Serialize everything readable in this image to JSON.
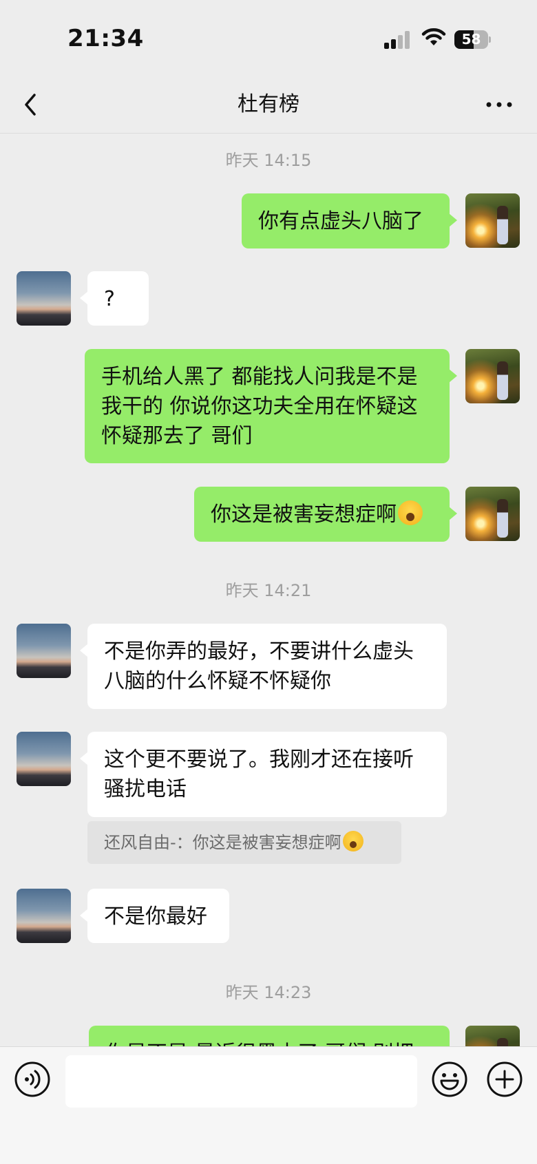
{
  "status_bar": {
    "time": "21:34",
    "battery_level": "58",
    "battery_fraction": 0.58
  },
  "header": {
    "back_icon": "chevron-left-icon",
    "title": "杜有榜",
    "more_icon": "more-dots-icon"
  },
  "messages": {
    "sep_1": "昨天 14:15",
    "m1": "你有点虚头八脑了",
    "m2": "?",
    "m3": "手机给人黑了 都能找人问我是不是\n我干的 你说你这功夫全用在怀疑这\n怀疑那去了 哥们",
    "m4": "你这是被害妄想症啊",
    "sep_2": "昨天 14:21",
    "m5": "不是你弄的最好，不要讲什么虚头\n八脑的什么怀疑不怀疑你",
    "m6": "这个更不要说了。我刚才还在接听\n骚扰电话",
    "quote": "还风自由-：你这是被害妄想症啊",
    "m7": "不是你最好",
    "sep_3": "昨天 14:23",
    "m8_partial": "你是不是 最近很黑占了 哥们 别把"
  },
  "input_bar": {
    "voice_icon": "voice-icon",
    "emoji_icon": "emoji-icon",
    "plus_icon": "plus-icon"
  },
  "colors": {
    "self_bubble": "#95ec69",
    "other_bubble": "#ffffff",
    "background": "#ededed"
  }
}
